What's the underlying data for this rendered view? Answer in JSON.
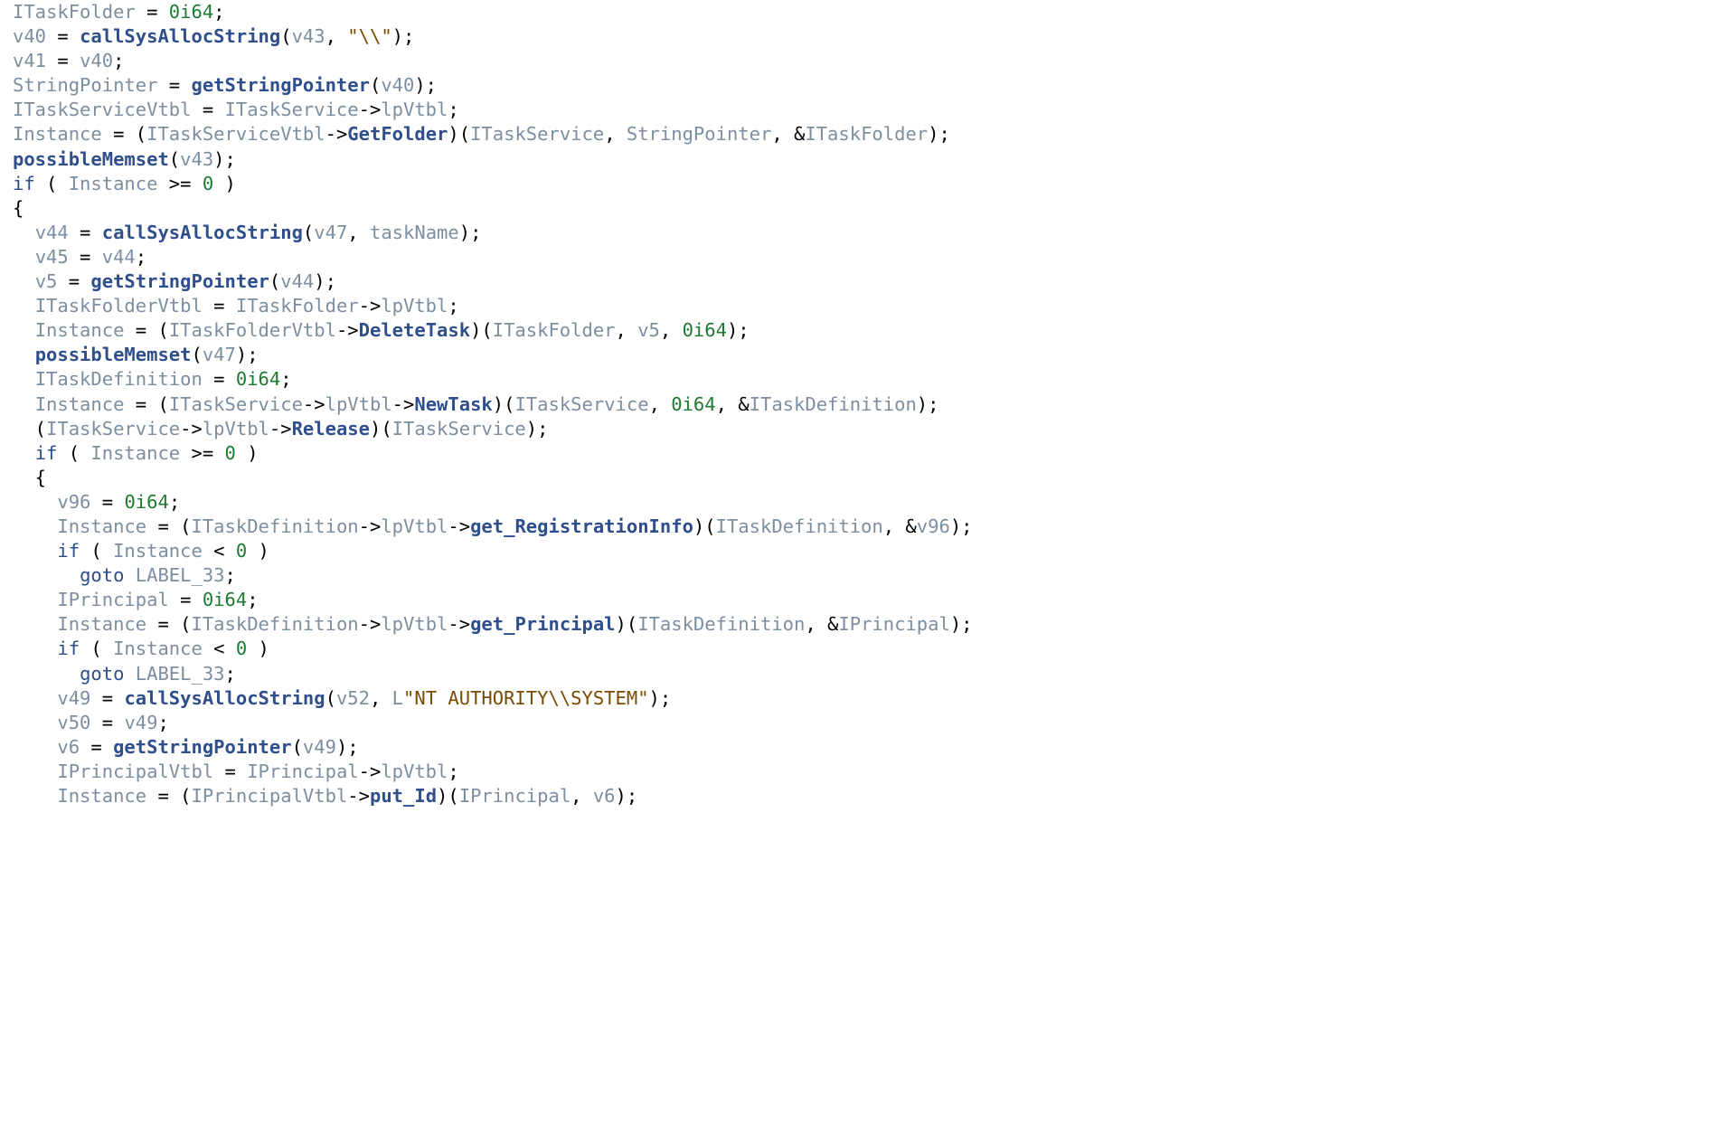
{
  "code": {
    "lines": [
      [
        [
          "var",
          "ITaskFolder"
        ],
        [
          "def",
          " = "
        ],
        [
          "num",
          "0i64"
        ],
        [
          "def",
          ";"
        ]
      ],
      [
        [
          "var",
          "v40"
        ],
        [
          "def",
          " = "
        ],
        [
          "call",
          "callSysAllocString"
        ],
        [
          "def",
          "("
        ],
        [
          "var",
          "v43"
        ],
        [
          "def",
          ", "
        ],
        [
          "str",
          "\"\\\\\""
        ],
        [
          "def",
          ");"
        ]
      ],
      [
        [
          "var",
          "v41"
        ],
        [
          "def",
          " = "
        ],
        [
          "var",
          "v40"
        ],
        [
          "def",
          ";"
        ]
      ],
      [
        [
          "var",
          "StringPointer"
        ],
        [
          "def",
          " = "
        ],
        [
          "call",
          "getStringPointer"
        ],
        [
          "def",
          "("
        ],
        [
          "var",
          "v40"
        ],
        [
          "def",
          ");"
        ]
      ],
      [
        [
          "var",
          "ITaskServiceVtbl"
        ],
        [
          "def",
          " = "
        ],
        [
          "var",
          "ITaskService"
        ],
        [
          "def",
          "->"
        ],
        [
          "var",
          "lpVtbl"
        ],
        [
          "def",
          ";"
        ]
      ],
      [
        [
          "var",
          "Instance"
        ],
        [
          "def",
          " = ("
        ],
        [
          "var",
          "ITaskServiceVtbl"
        ],
        [
          "def",
          "->"
        ],
        [
          "call",
          "GetFolder"
        ],
        [
          "def",
          ")("
        ],
        [
          "var",
          "ITaskService"
        ],
        [
          "def",
          ", "
        ],
        [
          "var",
          "StringPointer"
        ],
        [
          "def",
          ", &"
        ],
        [
          "var",
          "ITaskFolder"
        ],
        [
          "def",
          ");"
        ]
      ],
      [
        [
          "call",
          "possibleMemset"
        ],
        [
          "def",
          "("
        ],
        [
          "var",
          "v43"
        ],
        [
          "def",
          ");"
        ]
      ],
      [
        [
          "kw",
          "if"
        ],
        [
          "def",
          " ( "
        ],
        [
          "var",
          "Instance"
        ],
        [
          "def",
          " >= "
        ],
        [
          "num",
          "0"
        ],
        [
          "def",
          " )"
        ]
      ],
      [
        [
          "def",
          "{"
        ]
      ],
      [
        [
          "def",
          "  "
        ],
        [
          "var",
          "v44"
        ],
        [
          "def",
          " = "
        ],
        [
          "call",
          "callSysAllocString"
        ],
        [
          "def",
          "("
        ],
        [
          "var",
          "v47"
        ],
        [
          "def",
          ", "
        ],
        [
          "var",
          "taskName"
        ],
        [
          "def",
          ");"
        ]
      ],
      [
        [
          "def",
          "  "
        ],
        [
          "var",
          "v45"
        ],
        [
          "def",
          " = "
        ],
        [
          "var",
          "v44"
        ],
        [
          "def",
          ";"
        ]
      ],
      [
        [
          "def",
          "  "
        ],
        [
          "var",
          "v5"
        ],
        [
          "def",
          " = "
        ],
        [
          "call",
          "getStringPointer"
        ],
        [
          "def",
          "("
        ],
        [
          "var",
          "v44"
        ],
        [
          "def",
          ");"
        ]
      ],
      [
        [
          "def",
          "  "
        ],
        [
          "var",
          "ITaskFolderVtbl"
        ],
        [
          "def",
          " = "
        ],
        [
          "var",
          "ITaskFolder"
        ],
        [
          "def",
          "->"
        ],
        [
          "var",
          "lpVtbl"
        ],
        [
          "def",
          ";"
        ]
      ],
      [
        [
          "def",
          "  "
        ],
        [
          "var",
          "Instance"
        ],
        [
          "def",
          " = ("
        ],
        [
          "var",
          "ITaskFolderVtbl"
        ],
        [
          "def",
          "->"
        ],
        [
          "call",
          "DeleteTask"
        ],
        [
          "def",
          ")("
        ],
        [
          "var",
          "ITaskFolder"
        ],
        [
          "def",
          ", "
        ],
        [
          "var",
          "v5"
        ],
        [
          "def",
          ", "
        ],
        [
          "num",
          "0i64"
        ],
        [
          "def",
          ");"
        ]
      ],
      [
        [
          "def",
          "  "
        ],
        [
          "call",
          "possibleMemset"
        ],
        [
          "def",
          "("
        ],
        [
          "var",
          "v47"
        ],
        [
          "def",
          ");"
        ]
      ],
      [
        [
          "def",
          "  "
        ],
        [
          "var",
          "ITaskDefinition"
        ],
        [
          "def",
          " = "
        ],
        [
          "num",
          "0i64"
        ],
        [
          "def",
          ";"
        ]
      ],
      [
        [
          "def",
          "  "
        ],
        [
          "var",
          "Instance"
        ],
        [
          "def",
          " = ("
        ],
        [
          "var",
          "ITaskService"
        ],
        [
          "def",
          "->"
        ],
        [
          "var",
          "lpVtbl"
        ],
        [
          "def",
          "->"
        ],
        [
          "call",
          "NewTask"
        ],
        [
          "def",
          ")("
        ],
        [
          "var",
          "ITaskService"
        ],
        [
          "def",
          ", "
        ],
        [
          "num",
          "0i64"
        ],
        [
          "def",
          ", &"
        ],
        [
          "var",
          "ITaskDefinition"
        ],
        [
          "def",
          ");"
        ]
      ],
      [
        [
          "def",
          "  ("
        ],
        [
          "var",
          "ITaskService"
        ],
        [
          "def",
          "->"
        ],
        [
          "var",
          "lpVtbl"
        ],
        [
          "def",
          "->"
        ],
        [
          "call",
          "Release"
        ],
        [
          "def",
          ")("
        ],
        [
          "var",
          "ITaskService"
        ],
        [
          "def",
          ");"
        ]
      ],
      [
        [
          "def",
          "  "
        ],
        [
          "kw",
          "if"
        ],
        [
          "def",
          " ( "
        ],
        [
          "var",
          "Instance"
        ],
        [
          "def",
          " >= "
        ],
        [
          "num",
          "0"
        ],
        [
          "def",
          " )"
        ]
      ],
      [
        [
          "def",
          "  {"
        ]
      ],
      [
        [
          "def",
          "    "
        ],
        [
          "var",
          "v96"
        ],
        [
          "def",
          " = "
        ],
        [
          "num",
          "0i64"
        ],
        [
          "def",
          ";"
        ]
      ],
      [
        [
          "def",
          "    "
        ],
        [
          "var",
          "Instance"
        ],
        [
          "def",
          " = ("
        ],
        [
          "var",
          "ITaskDefinition"
        ],
        [
          "def",
          "->"
        ],
        [
          "var",
          "lpVtbl"
        ],
        [
          "def",
          "->"
        ],
        [
          "call",
          "get_RegistrationInfo"
        ],
        [
          "def",
          ")("
        ],
        [
          "var",
          "ITaskDefinition"
        ],
        [
          "def",
          ", &"
        ],
        [
          "var",
          "v96"
        ],
        [
          "def",
          ");"
        ]
      ],
      [
        [
          "def",
          "    "
        ],
        [
          "kw",
          "if"
        ],
        [
          "def",
          " ( "
        ],
        [
          "var",
          "Instance"
        ],
        [
          "def",
          " < "
        ],
        [
          "num",
          "0"
        ],
        [
          "def",
          " )"
        ]
      ],
      [
        [
          "def",
          "      "
        ],
        [
          "kw",
          "goto"
        ],
        [
          "def",
          " "
        ],
        [
          "var",
          "LABEL_33"
        ],
        [
          "def",
          ";"
        ]
      ],
      [
        [
          "def",
          "    "
        ],
        [
          "var",
          "IPrincipal"
        ],
        [
          "def",
          " = "
        ],
        [
          "num",
          "0i64"
        ],
        [
          "def",
          ";"
        ]
      ],
      [
        [
          "def",
          "    "
        ],
        [
          "var",
          "Instance"
        ],
        [
          "def",
          " = ("
        ],
        [
          "var",
          "ITaskDefinition"
        ],
        [
          "def",
          "->"
        ],
        [
          "var",
          "lpVtbl"
        ],
        [
          "def",
          "->"
        ],
        [
          "call",
          "get_Principal"
        ],
        [
          "def",
          ")("
        ],
        [
          "var",
          "ITaskDefinition"
        ],
        [
          "def",
          ", &"
        ],
        [
          "var",
          "IPrincipal"
        ],
        [
          "def",
          ");"
        ]
      ],
      [
        [
          "def",
          "    "
        ],
        [
          "kw",
          "if"
        ],
        [
          "def",
          " ( "
        ],
        [
          "var",
          "Instance"
        ],
        [
          "def",
          " < "
        ],
        [
          "num",
          "0"
        ],
        [
          "def",
          " )"
        ]
      ],
      [
        [
          "def",
          "      "
        ],
        [
          "kw",
          "goto"
        ],
        [
          "def",
          " "
        ],
        [
          "var",
          "LABEL_33"
        ],
        [
          "def",
          ";"
        ]
      ],
      [
        [
          "def",
          "    "
        ],
        [
          "var",
          "v49"
        ],
        [
          "def",
          " = "
        ],
        [
          "call",
          "callSysAllocString"
        ],
        [
          "def",
          "("
        ],
        [
          "var",
          "v52"
        ],
        [
          "def",
          ", "
        ],
        [
          "var",
          "L"
        ],
        [
          "str",
          "\"NT AUTHORITY\\\\SYSTEM\""
        ],
        [
          "def",
          ");"
        ]
      ],
      [
        [
          "def",
          "    "
        ],
        [
          "var",
          "v50"
        ],
        [
          "def",
          " = "
        ],
        [
          "var",
          "v49"
        ],
        [
          "def",
          ";"
        ]
      ],
      [
        [
          "def",
          "    "
        ],
        [
          "var",
          "v6"
        ],
        [
          "def",
          " = "
        ],
        [
          "call",
          "getStringPointer"
        ],
        [
          "def",
          "("
        ],
        [
          "var",
          "v49"
        ],
        [
          "def",
          ");"
        ]
      ],
      [
        [
          "def",
          "    "
        ],
        [
          "var",
          "IPrincipalVtbl"
        ],
        [
          "def",
          " = "
        ],
        [
          "var",
          "IPrincipal"
        ],
        [
          "def",
          "->"
        ],
        [
          "var",
          "lpVtbl"
        ],
        [
          "def",
          ";"
        ]
      ],
      [
        [
          "def",
          "    "
        ],
        [
          "var",
          "Instance"
        ],
        [
          "def",
          " = ("
        ],
        [
          "var",
          "IPrincipalVtbl"
        ],
        [
          "def",
          "->"
        ],
        [
          "call",
          "put_Id"
        ],
        [
          "def",
          ")("
        ],
        [
          "var",
          "IPrincipal"
        ],
        [
          "def",
          ", "
        ],
        [
          "var",
          "v6"
        ],
        [
          "def",
          ");"
        ]
      ]
    ]
  }
}
